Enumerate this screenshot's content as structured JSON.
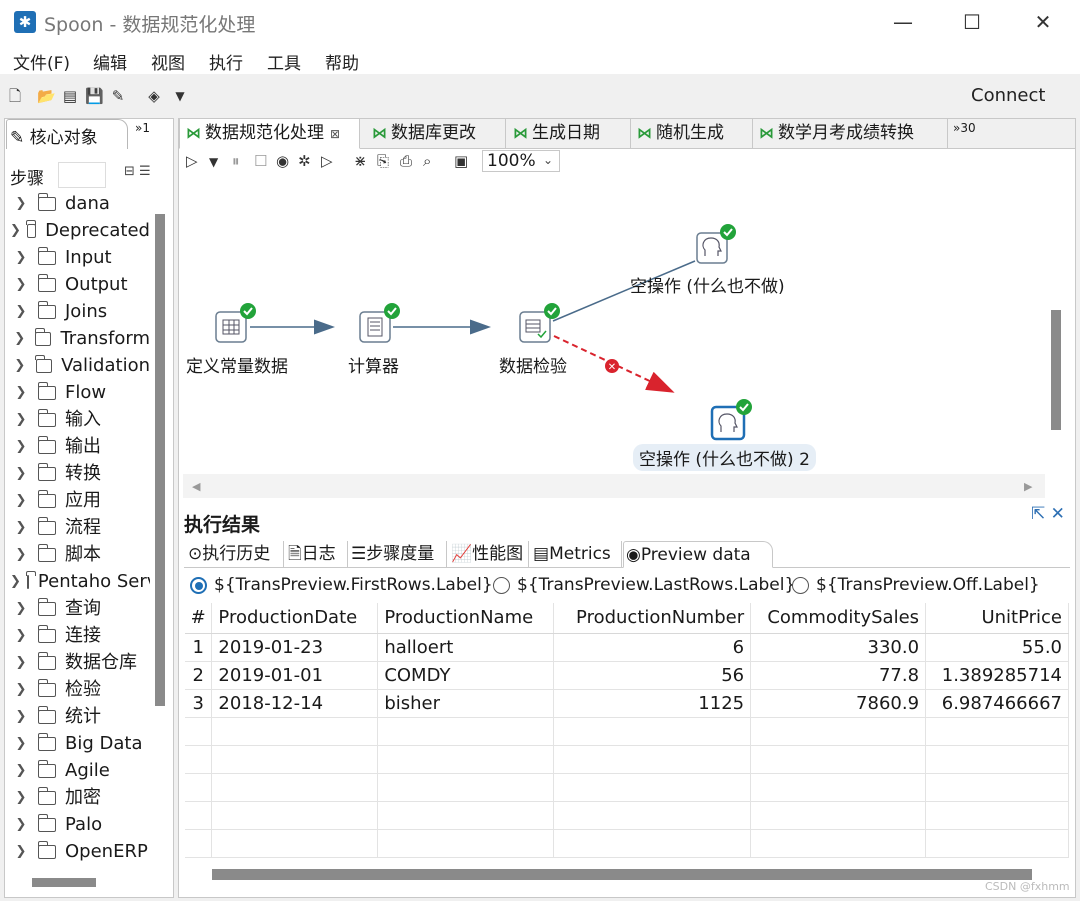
{
  "window": {
    "title": "Spoon - 数据规范化处理",
    "minimize": "—",
    "maximize": "☐",
    "close": "✕"
  },
  "menu": [
    "文件(F)",
    "编辑",
    "视图",
    "执行",
    "工具",
    "帮助"
  ],
  "toolbar": {
    "connect": "Connect"
  },
  "left": {
    "tab_label": "核心对象",
    "tab_more": "»1",
    "steps_label": "步骤",
    "tree": [
      "dana",
      "Deprecated",
      "Input",
      "Output",
      "Joins",
      "Transform",
      "Validation",
      "Flow",
      "输入",
      "输出",
      "转换",
      "应用",
      "流程",
      "脚本",
      "Pentaho Server",
      "查询",
      "连接",
      "数据仓库",
      "检验",
      "统计",
      "Big Data",
      "Agile",
      "加密",
      "Palo",
      "OpenERP"
    ]
  },
  "file_tabs": {
    "items": [
      "数据规范化处理",
      "数据库更改",
      "生成日期",
      "随机生成",
      "数学月考成绩转换"
    ],
    "more": "»30"
  },
  "zoom": "100%",
  "canvas": {
    "nodes": [
      "定义常量数据",
      "计算器",
      "数据检验",
      "空操作 (什么也不做)",
      "空操作 (什么也不做) 2"
    ]
  },
  "results": {
    "title": "执行结果",
    "tabs": [
      "执行历史",
      "日志",
      "步骤度量",
      "性能图",
      "Metrics",
      "Preview data"
    ],
    "radios": [
      "${TransPreview.FirstRows.Label}",
      "${TransPreview.LastRows.Label}",
      "${TransPreview.Off.Label}"
    ],
    "columns": [
      "#",
      "ProductionDate",
      "ProductionName",
      "ProductionNumber",
      "CommoditySales",
      "UnitPrice"
    ],
    "rows": [
      [
        "1",
        "2019-01-23",
        "halloert",
        "6",
        "330.0",
        "55.0"
      ],
      [
        "2",
        "2019-01-01",
        "COMDY",
        "56",
        "77.8",
        "1.389285714"
      ],
      [
        "3",
        "2018-12-14",
        "bisher",
        "1125",
        "7860.9",
        "6.987466667"
      ]
    ]
  },
  "watermark": "CSDN @fxhmm",
  "colors": {
    "accent": "#1f6fb5",
    "ok": "#22a33a",
    "error": "#d9232d",
    "hop": "#4a6b8a"
  }
}
